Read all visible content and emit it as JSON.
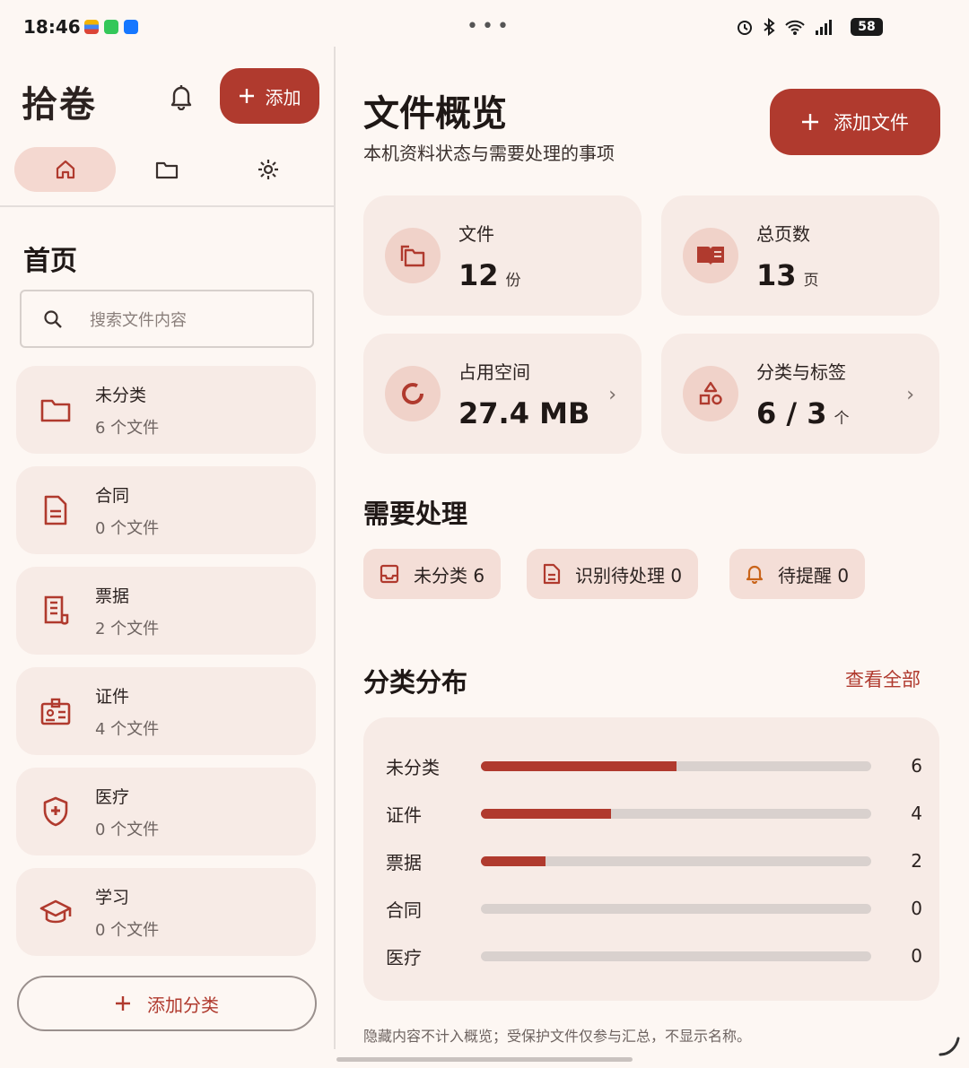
{
  "status_bar": {
    "time": "18:46",
    "battery": "58"
  },
  "sidebar": {
    "brand": "拾卷",
    "add_label": "添加",
    "page_heading": "首页",
    "search_placeholder": "搜索文件内容",
    "categories": [
      {
        "name": "未分类",
        "count": "6 个文件",
        "icon": "folder-icon"
      },
      {
        "name": "合同",
        "count": "0 个文件",
        "icon": "document-icon"
      },
      {
        "name": "票据",
        "count": "2 个文件",
        "icon": "receipt-icon"
      },
      {
        "name": "证件",
        "count": "4 个文件",
        "icon": "id-card-icon"
      },
      {
        "name": "医疗",
        "count": "0 个文件",
        "icon": "medical-shield-icon"
      },
      {
        "name": "学习",
        "count": "0 个文件",
        "icon": "graduation-cap-icon"
      }
    ],
    "add_category_label": "添加分类"
  },
  "main": {
    "title": "文件概览",
    "subtitle": "本机资料状态与需要处理的事项",
    "add_file_label": "添加文件",
    "stats": {
      "files": {
        "label": "文件",
        "value": "12",
        "unit": "份"
      },
      "pages": {
        "label": "总页数",
        "value": "13",
        "unit": "页"
      },
      "storage": {
        "label": "占用空间",
        "value": "27.4 MB"
      },
      "categories": {
        "label": "分类与标签",
        "value": "6 / 3",
        "unit": "个"
      }
    },
    "todo_title": "需要处理",
    "todo_chips": [
      {
        "label": "未分类 6",
        "icon": "inbox-icon"
      },
      {
        "label": "识别待处理 0",
        "icon": "document-text-icon"
      },
      {
        "label": "待提醒 0",
        "icon": "bell-icon"
      }
    ],
    "distribution_title": "分类分布",
    "view_all_label": "查看全部",
    "footnote": "隐藏内容不计入概览；受保护文件仅参与汇总，不显示名称。"
  },
  "chart_data": {
    "type": "bar",
    "categories": [
      "未分类",
      "证件",
      "票据",
      "合同",
      "医疗"
    ],
    "values": [
      6,
      4,
      2,
      0,
      0
    ],
    "xlim": [
      0,
      12
    ]
  },
  "colors": {
    "accent": "#b03a2e",
    "card": "#f7ebe6",
    "background": "#fdf7f3"
  }
}
